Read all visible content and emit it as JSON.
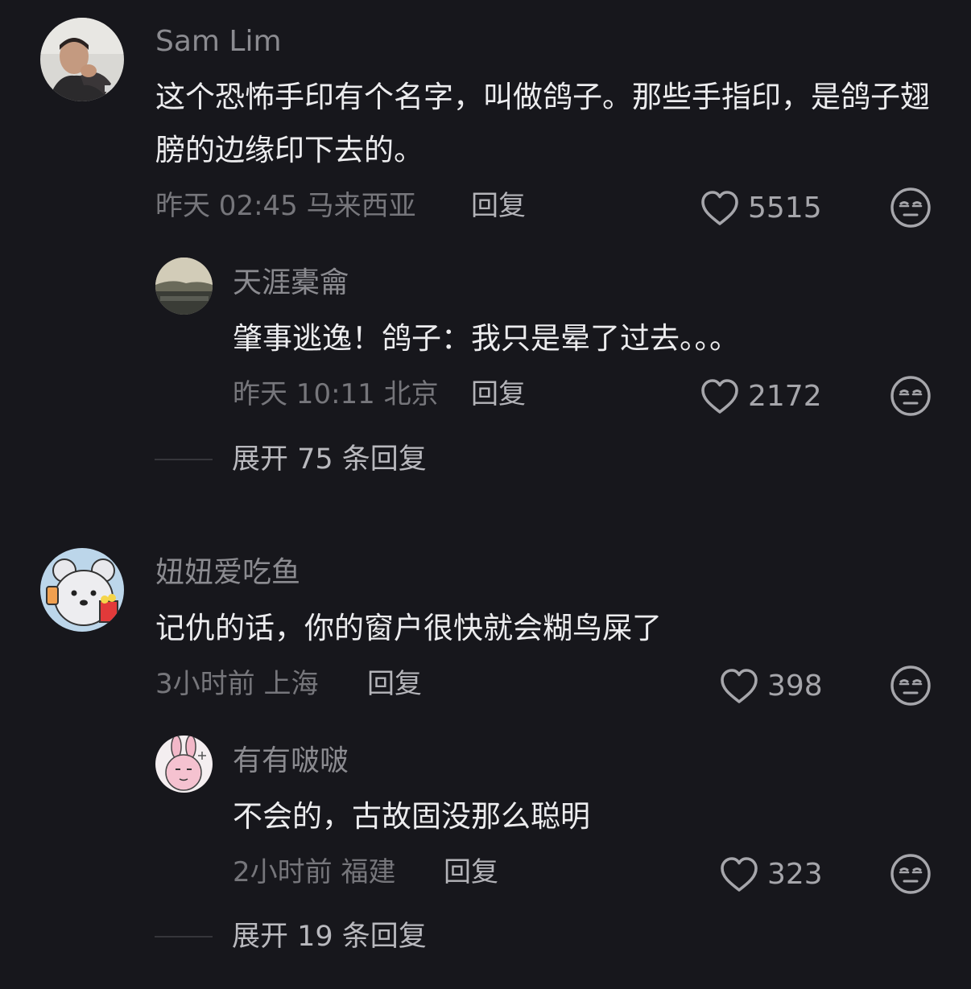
{
  "comments": [
    {
      "user": "Sam Lim",
      "text": "这个恐怖手印有个名字，叫做鸽子。那些手指印，是鸽子翅膀的边缘印下去的。",
      "time": "昨天 02:45 马来西亚",
      "reply_label": "回复",
      "likes": "5515",
      "replies": [
        {
          "user": "天涯橐龠",
          "text": "肇事逃逸！鸽子：我只是晕了过去。。。",
          "time": "昨天 10:11 北京",
          "reply_label": "回复",
          "likes": "2172"
        }
      ],
      "expand_label": "展开 75 条回复"
    },
    {
      "user": "妞妞爱吃鱼",
      "text": "记仇的话，你的窗户很快就会糊鸟屎了",
      "time": "3小时前 上海",
      "reply_label": "回复",
      "likes": "398",
      "replies": [
        {
          "user": "有有啵啵",
          "text": "不会的，古故固没那么聪明",
          "time": "2小时前 福建",
          "reply_label": "回复",
          "likes": "323"
        }
      ],
      "expand_label": "展开 19 条回复"
    }
  ],
  "icons": {
    "like": "heart-outline-icon",
    "dislike": "unamused-face-icon"
  },
  "colors": {
    "background": "#17171c",
    "body_text": "#ececee",
    "meta_text": "#76767b"
  }
}
